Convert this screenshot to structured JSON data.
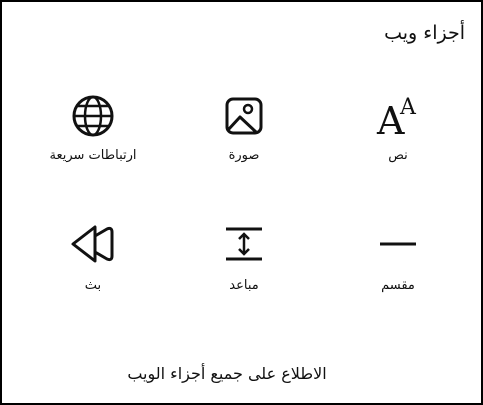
{
  "panel": {
    "title": "أجزاء ويب"
  },
  "tiles": [
    {
      "label": "نص",
      "icon": "text-aa-icon"
    },
    {
      "label": "صورة",
      "icon": "image-icon"
    },
    {
      "label": "ارتباطات سريعة",
      "icon": "globe-icon"
    },
    {
      "label": "مقسم",
      "icon": "divider-line-icon"
    },
    {
      "label": "مباعد",
      "icon": "spacer-icon"
    },
    {
      "label": "بث",
      "icon": "stream-rewind-icon"
    }
  ],
  "footer": {
    "see_all": "الاطلاع على جميع أجزاء الويب"
  }
}
